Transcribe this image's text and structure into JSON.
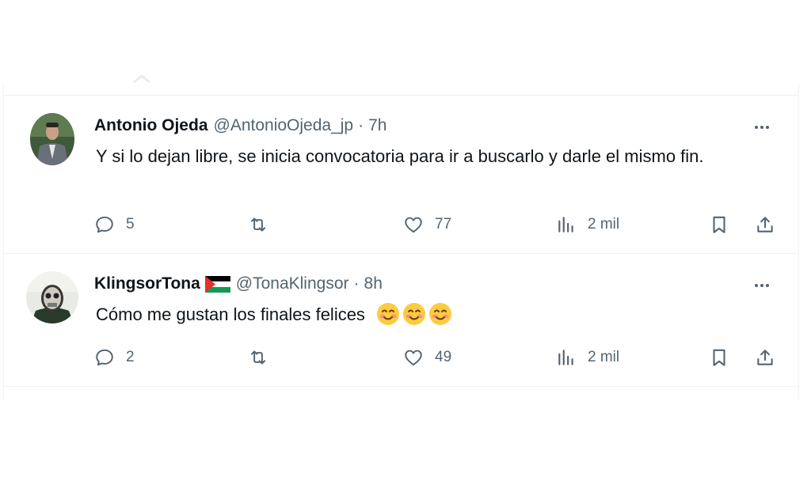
{
  "tweets": [
    {
      "name": "Antonio Ojeda",
      "handle": "@AntonioOjeda_jp",
      "separator": "·",
      "time": "7h",
      "text": "Y si lo dejan libre, se inicia convocatoria para ir a buscarlo y darle el mismo fin.",
      "replies": "5",
      "reposts": "",
      "likes": "77",
      "views": "2 mil"
    },
    {
      "name": "KlingsorTona",
      "flag_icon": "palestine-flag-icon",
      "handle": "@TonaKlingsor",
      "separator": "·",
      "time": "8h",
      "text": "Cómo me gustan los finales felices",
      "emojis": [
        "smiling-face-icon",
        "smiling-face-icon",
        "smiling-face-icon"
      ],
      "replies": "2",
      "reposts": "",
      "likes": "49",
      "views": "2 mil"
    }
  ],
  "colors": {
    "text": "#0f1419",
    "secondary": "#536471",
    "border": "#eff3f4"
  }
}
